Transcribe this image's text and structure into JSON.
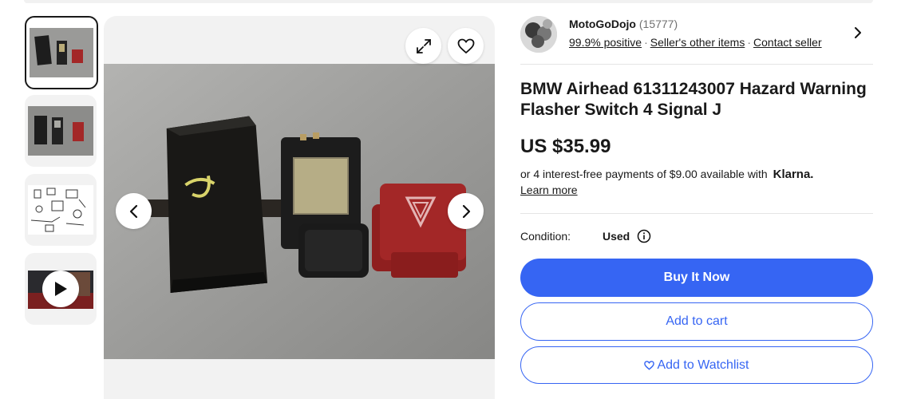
{
  "seller": {
    "name": "MotoGoDojo",
    "feedback_count": "(15777)",
    "positive": "99.9% positive",
    "other_items": "Seller's other items",
    "contact": "Contact seller"
  },
  "listing": {
    "title": "BMW Airhead 61311243007 Hazard Warning Flasher Switch 4 Signal J",
    "price": "US $35.99",
    "installment_text": "or 4 interest-free payments of $9.00 available with",
    "klarna": "Klarna.",
    "learn_more": "Learn more",
    "condition_label": "Condition:",
    "condition_value": "Used"
  },
  "actions": {
    "buy_now": "Buy It Now",
    "add_to_cart": "Add to cart",
    "add_to_watchlist": "Add to Watchlist"
  },
  "colors": {
    "accent": "#3665f3",
    "switch_red": "#a32727"
  },
  "icons": [
    "expand-icon",
    "heart-icon",
    "chevron-left-icon",
    "chevron-right-icon",
    "info-icon",
    "play-icon"
  ]
}
